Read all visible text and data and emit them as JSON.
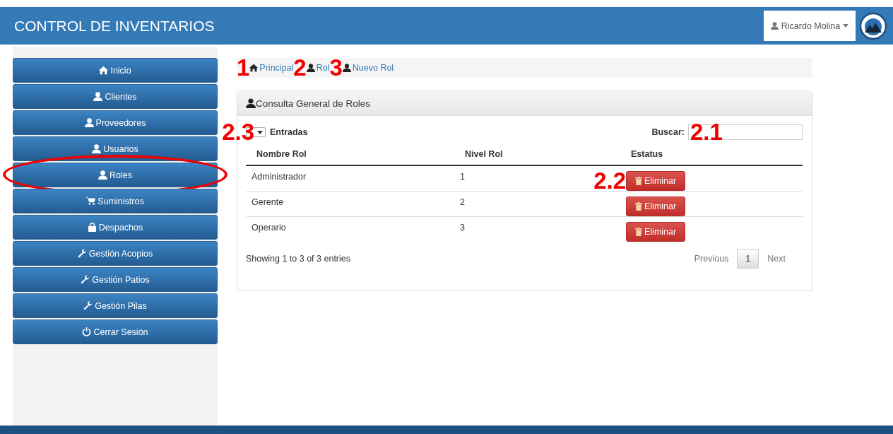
{
  "header": {
    "title": "CONTROL DE INVENTARIOS",
    "user": "Ricardo Molina"
  },
  "sidebar": {
    "items": [
      {
        "label": "Inicio",
        "kind": "home",
        "circled": false
      },
      {
        "label": "Clientes",
        "kind": "user",
        "circled": false
      },
      {
        "label": "Proveedores",
        "kind": "user",
        "circled": false
      },
      {
        "label": "Usuarios",
        "kind": "user",
        "circled": false
      },
      {
        "label": "Roles",
        "kind": "user",
        "circled": true
      },
      {
        "label": "Suministros",
        "kind": "cart",
        "circled": false
      },
      {
        "label": "Despachos",
        "kind": "bag",
        "circled": false
      },
      {
        "label": "Gestión Acopios",
        "kind": "wrench",
        "circled": false
      },
      {
        "label": "Gestión Patios",
        "kind": "wrench",
        "circled": false
      },
      {
        "label": "Gestión Pilas",
        "kind": "wrench",
        "circled": false
      },
      {
        "label": "Cerrar Sesión",
        "kind": "power",
        "circled": false
      }
    ]
  },
  "breadcrumb": [
    {
      "label": "Principal",
      "kind": "home",
      "marker": "1"
    },
    {
      "label": "Rol",
      "kind": "user",
      "marker": "2"
    },
    {
      "label": "Nuevo Rol",
      "kind": "user",
      "marker": "3"
    }
  ],
  "panel": {
    "title": "Consulta General de Roles",
    "entries_marker": "2.3",
    "entries_label": "Entradas",
    "search_label": "Buscar:",
    "search_marker": "2.1",
    "columns": [
      "Nombre Rol",
      "Nivel Rol",
      "Estatus"
    ],
    "rows": [
      {
        "name": "Administrador",
        "nivel": "1",
        "action": "Eliminar",
        "marker": "2.2"
      },
      {
        "name": "Gerente",
        "nivel": "2",
        "action": "Eliminar"
      },
      {
        "name": "Operario",
        "nivel": "3",
        "action": "Eliminar"
      }
    ],
    "info": "Showing 1 to 3 of 3 entries",
    "pagination": {
      "previous": "Previous",
      "pages": [
        {
          "label": "1",
          "selected": true
        }
      ],
      "next": "Next"
    }
  }
}
